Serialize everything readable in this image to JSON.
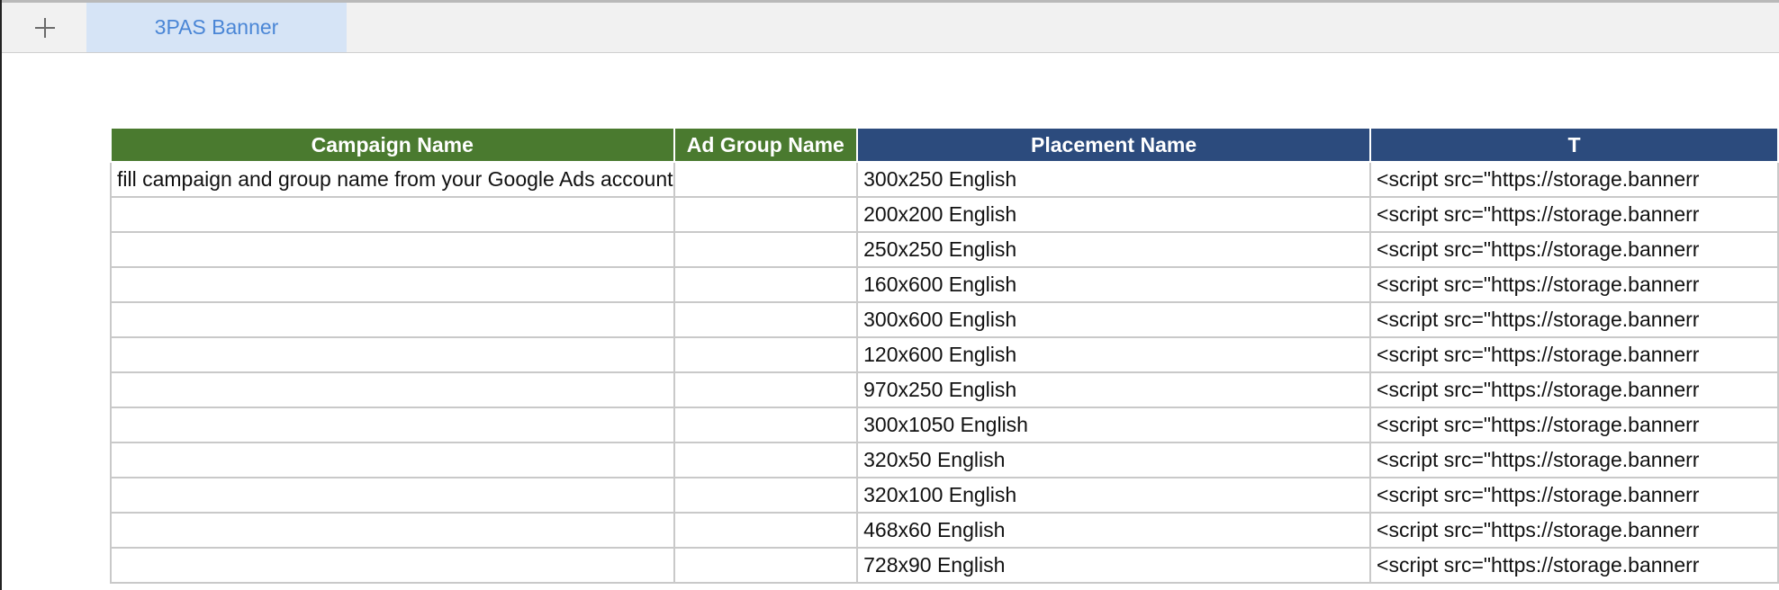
{
  "tabs": {
    "add_label": "+",
    "active_tab": "3PAS Banner"
  },
  "table": {
    "headers": {
      "campaign": "Campaign Name",
      "ad_group": "Ad Group Name",
      "placement": "Placement Name",
      "tag": "T"
    },
    "colors": {
      "green_header": "#4a7a2f",
      "blue_header": "#2c4b7d",
      "tab_active_bg": "#d6e4f6",
      "tab_active_text": "#4a86d6"
    },
    "note": "fill campaign and group name from your Google Ads account",
    "rows": [
      {
        "placement": "300x250 English",
        "tag": "<script src=\"https://storage.bannerr"
      },
      {
        "placement": "200x200 English",
        "tag": "<script src=\"https://storage.bannerr"
      },
      {
        "placement": "250x250 English",
        "tag": "<script src=\"https://storage.bannerr"
      },
      {
        "placement": "160x600 English",
        "tag": "<script src=\"https://storage.bannerr"
      },
      {
        "placement": "300x600 English",
        "tag": "<script src=\"https://storage.bannerr"
      },
      {
        "placement": "120x600 English",
        "tag": "<script src=\"https://storage.bannerr"
      },
      {
        "placement": "970x250 English",
        "tag": "<script src=\"https://storage.bannerr"
      },
      {
        "placement": "300x1050 English",
        "tag": "<script src=\"https://storage.bannerr"
      },
      {
        "placement": "320x50 English",
        "tag": "<script src=\"https://storage.bannerr"
      },
      {
        "placement": "320x100 English",
        "tag": "<script src=\"https://storage.bannerr"
      },
      {
        "placement": "468x60 English",
        "tag": "<script src=\"https://storage.bannerr"
      },
      {
        "placement": "728x90 English",
        "tag": "<script src=\"https://storage.bannerr"
      }
    ]
  }
}
